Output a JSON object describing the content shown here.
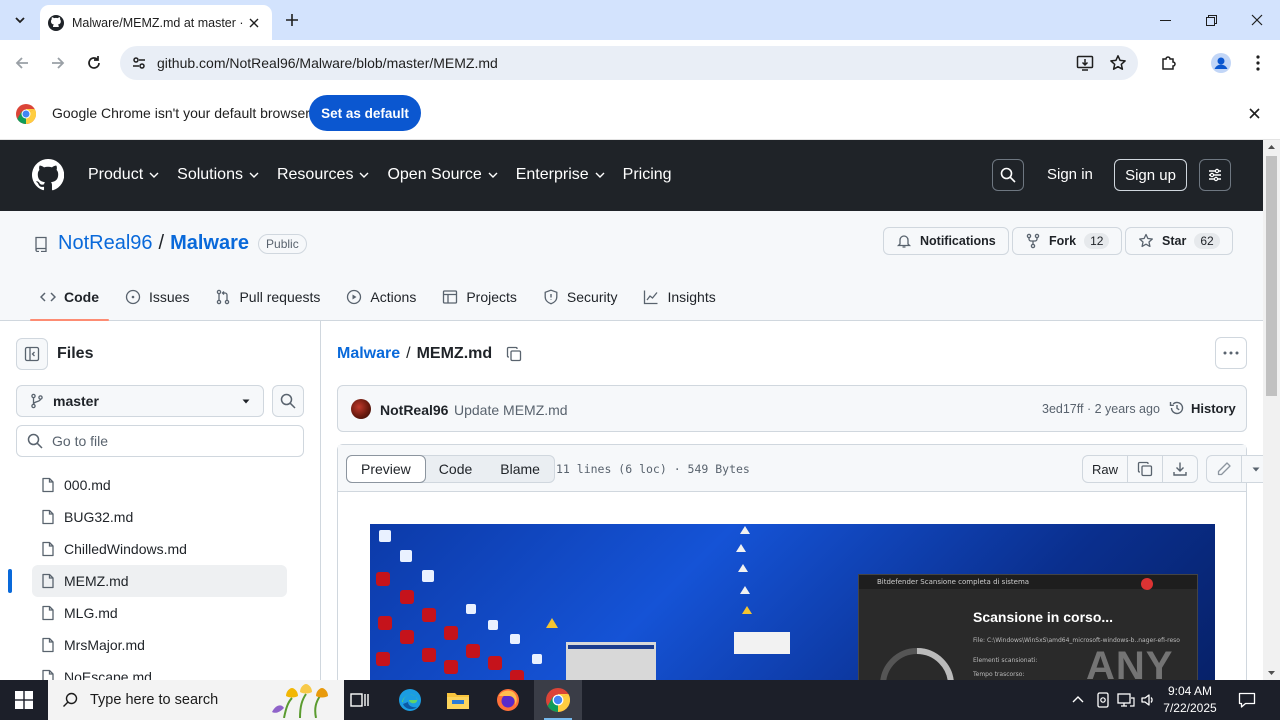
{
  "browser": {
    "tab_title": "Malware/MEMZ.md at master · ",
    "url": "github.com/NotReal96/Malware/blob/master/MEMZ.md",
    "infobar_message": "Google Chrome isn't your default browser",
    "infobar_button": "Set as default"
  },
  "github_nav": {
    "items": [
      "Product",
      "Solutions",
      "Resources",
      "Open Source",
      "Enterprise",
      "Pricing"
    ],
    "sign_in": "Sign in",
    "sign_up": "Sign up"
  },
  "repo": {
    "owner": "NotReal96",
    "name": "Malware",
    "visibility": "Public",
    "notifications_label": "Notifications",
    "fork_label": "Fork",
    "fork_count": "12",
    "star_label": "Star",
    "star_count": "62",
    "tabs": [
      "Code",
      "Issues",
      "Pull requests",
      "Actions",
      "Projects",
      "Security",
      "Insights"
    ]
  },
  "sidebar": {
    "title": "Files",
    "branch": "master",
    "goto_placeholder": "Go to file",
    "files": [
      "000.md",
      "BUG32.md",
      "ChilledWindows.md",
      "MEMZ.md",
      "MLG.md",
      "MrsMajor.md",
      "NoEscape.md"
    ],
    "selected_file": "MEMZ.md"
  },
  "file": {
    "breadcrumb_repo": "Malware",
    "breadcrumb_file": "MEMZ.md",
    "commit_author": "NotReal96",
    "commit_message": "Update MEMZ.md",
    "commit_sha_time": "3ed17ff · 2 years ago",
    "history_label": "History",
    "view_modes": [
      "Preview",
      "Code",
      "Blame"
    ],
    "meta": "11 lines (6 loc) · 549 Bytes",
    "raw_label": "Raw"
  },
  "screenshot_preview": {
    "window_title": "Bitdefender Scansione completa di sistema",
    "heading": "Scansione in corso...",
    "line1": "File:  C:\\Windows\\WinSxS\\amd64_microsoft-windows-b..nager-efi-reso",
    "line2": "Elementi scansionati:",
    "line3": "Tempo trascorso:",
    "watermark": "ANY RUN"
  },
  "taskbar": {
    "search_placeholder": "Type here to search",
    "time": "9:04 AM",
    "date": "7/22/2025"
  }
}
